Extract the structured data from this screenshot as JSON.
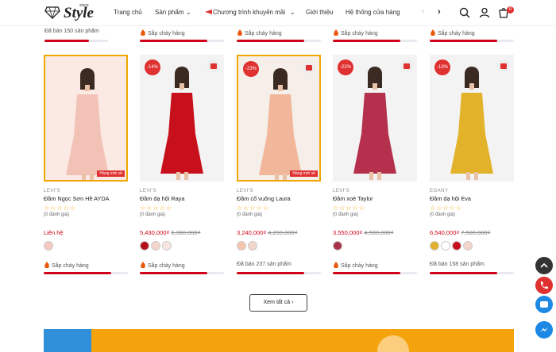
{
  "header": {
    "logo_text": "Style",
    "logo_since": "since",
    "nav": [
      "Trang chủ",
      "Sản phẩm",
      "Chương trình khuyến mãi",
      "Giới thiệu",
      "Hệ thống cửa hàng"
    ],
    "cart_count": "0"
  },
  "top_row": {
    "sold_text": "Đã bán 150 sản phẩm",
    "hot_label": "Sắp cháy hàng"
  },
  "products": [
    {
      "brand": "LEVI'S",
      "name": "Đầm Ngọc Sơn Hề AYDA",
      "stars": "☆☆☆☆☆",
      "reviews": "(0 đánh giá)",
      "price": "Liên hệ",
      "old_price": "",
      "discount": "",
      "ribbon": "Hàng mới về",
      "status": "Sắp cháy hàng",
      "sold": "",
      "swatches": [
        "#f5c9c0"
      ],
      "bar": 0.8,
      "dress": "#f3c2b6",
      "bg": "#fbe9e3"
    },
    {
      "brand": "LEVI'S",
      "name": "Đầm dạ hội Raya",
      "stars": "☆☆☆☆☆",
      "reviews": "(0 đánh giá)",
      "price": "5,430,000₫",
      "old_price": "6,300,000₫",
      "discount": "-14%",
      "ribbon": "",
      "status": "Sắp cháy hàng",
      "sold": "",
      "swatches": [
        "#b3121c",
        "#f2d4cc",
        "#f7e5df"
      ],
      "bar": 0.8,
      "dress": "#c8101c",
      "bg": "#f3f3f3"
    },
    {
      "brand": "LEVI'S",
      "name": "Đầm cổ vuông Laura",
      "stars": "☆☆☆☆☆",
      "reviews": "(0 đánh giá)",
      "price": "3,240,000₫",
      "old_price": "4,200,000₫",
      "discount": "-23%",
      "ribbon": "Hàng mới về",
      "status": "",
      "sold": "Đã bán 237 sản phẩm",
      "swatches": [
        "#f4c5ae",
        "#f2d4cc"
      ],
      "bar": 0.8,
      "dress": "#f2b69a",
      "bg": "#f6efe9"
    },
    {
      "brand": "LEVI'S",
      "name": "Đầm xoè Taylor",
      "stars": "☆☆☆☆☆",
      "reviews": "(0 đánh giá)",
      "price": "3,550,000₫",
      "old_price": "4,500,000₫",
      "discount": "-22%",
      "ribbon": "",
      "status": "Sắp cháy hàng",
      "sold": "",
      "swatches": [
        "#a8324a"
      ],
      "bar": 0.8,
      "dress": "#b4304d",
      "bg": "#f3f3f3"
    },
    {
      "brand": "EGANY",
      "name": "Đầm dạ hội Eva",
      "stars": "☆☆☆☆☆",
      "reviews": "(0 đánh giá)",
      "price": "6,540,000₫",
      "old_price": "7,500,000₫",
      "discount": "-13%",
      "ribbon": "",
      "status": "",
      "sold": "Đã bán 158 sản phẩm",
      "swatches": [
        "#e2b02c",
        "#ffffff",
        "#c8101c",
        "#f2d4cc"
      ],
      "bar": 0.8,
      "dress": "#e2b22a",
      "bg": "#f3f3f3"
    }
  ],
  "see_all": "Xem tất cả",
  "colors": {
    "accent": "#d0021b",
    "gold": "#f0a800"
  }
}
